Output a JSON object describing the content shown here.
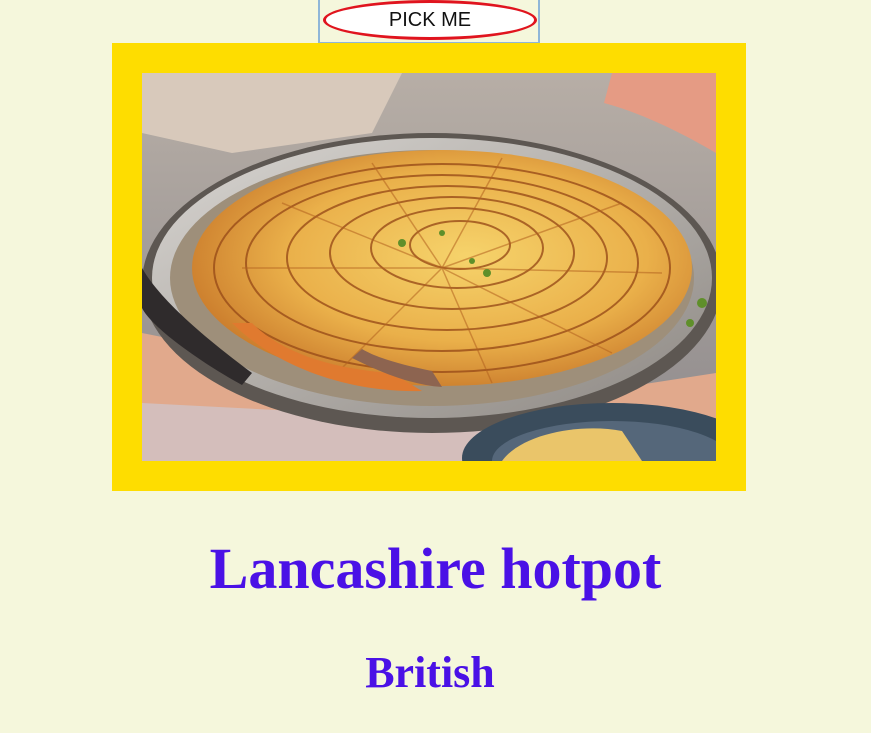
{
  "button": {
    "label": "PICK ME"
  },
  "recipe": {
    "name": "Lancashire hotpot",
    "area": "British",
    "image": {
      "alt": "Lancashire hotpot"
    }
  },
  "colors": {
    "page_background": "#f5f7dc",
    "frame": "#fedd00",
    "heading": "#4a11e6",
    "button_outline": "#e0141e"
  }
}
